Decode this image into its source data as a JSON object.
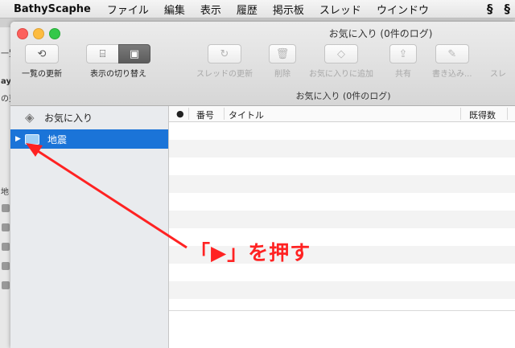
{
  "menubar": {
    "app": "BathyScaphe",
    "items": [
      "ファイル",
      "編集",
      "表示",
      "履歴",
      "掲示板",
      "スレッド",
      "ウインドウ"
    ]
  },
  "background_window": {
    "fragments": [
      "一覧の更新",
      "aySc",
      "の更",
      "地"
    ]
  },
  "window": {
    "title": "お気に入り (0件のログ)",
    "toolbar": {
      "reload_list": "一覧の更新",
      "toggle_view": "表示の切り替え",
      "refresh_thread": "スレッドの更新",
      "delete": "削除",
      "add_favorite": "お気に入りに追加",
      "share": "共有",
      "write": "書き込み...",
      "overflow": "スレ"
    },
    "subtitle": "お気に入り (0件のログ)"
  },
  "sidebar": {
    "favorites_label": "お気に入り",
    "selected_folder": "地震"
  },
  "table": {
    "columns": [
      "●",
      "番号",
      "タイトル",
      "既得数"
    ],
    "rows": []
  },
  "annotation": {
    "text": "「▶」を押す",
    "color": "#ff2222"
  },
  "colors": {
    "selection": "#1b74d8",
    "close": "#fc605c",
    "minimize": "#fdbc40",
    "maximize": "#34c84a"
  }
}
